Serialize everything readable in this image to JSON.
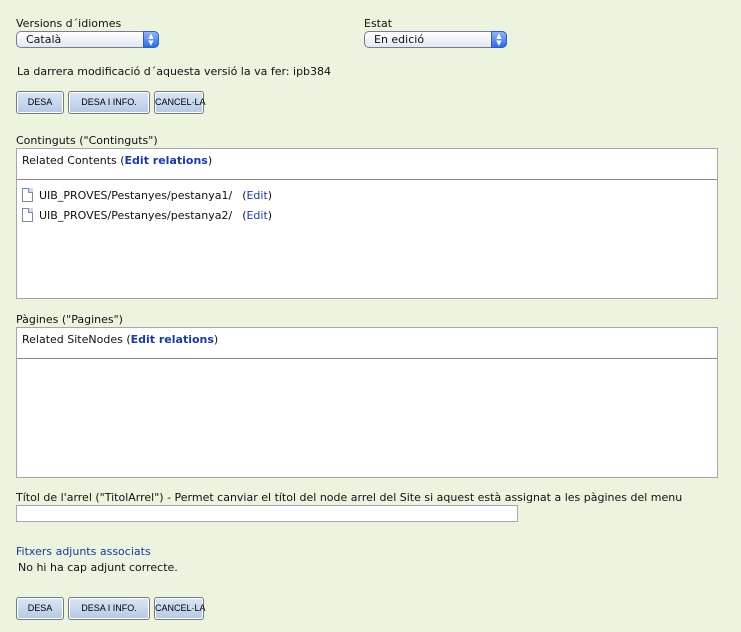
{
  "versions": {
    "label": "Versions d´idiomes",
    "selected": "Català"
  },
  "status": {
    "label": "Estat",
    "selected": "En edició"
  },
  "last_modified": "La darrera modificació d´aquesta versió la va fer: ipb384",
  "buttons_top": {
    "save": "DESA",
    "save_info": "DESA I INFO.",
    "cancel": "CANCEL·LA"
  },
  "contents": {
    "label": "Continguts (\"Continguts\")",
    "header_prefix": "Related Contents (",
    "edit_relations": "Edit relations",
    "header_suffix": ")",
    "items": [
      {
        "path": "UIB_PROVES/Pestanyes/pestanya1/",
        "edit": "Edit"
      },
      {
        "path": "UIB_PROVES/Pestanyes/pestanya2/",
        "edit": "Edit"
      }
    ]
  },
  "pages": {
    "label": "Pàgines (\"Pagines\")",
    "header_prefix": "Related SiteNodes (",
    "edit_relations": "Edit relations",
    "header_suffix": ")"
  },
  "root_title": {
    "label": "Títol de l'arrel (\"TitolArrel\") - Permet canviar el títol del node arrel del Site si aquest està assignat a les pàgines del menu",
    "value": ""
  },
  "attachments": {
    "label": "Fitxers adjunts associats",
    "message": "No hi ha cap adjunt correcte."
  },
  "buttons_bottom": {
    "save": "DESA",
    "save_info": "DESA I INFO.",
    "cancel": "CANCEL·LA"
  }
}
